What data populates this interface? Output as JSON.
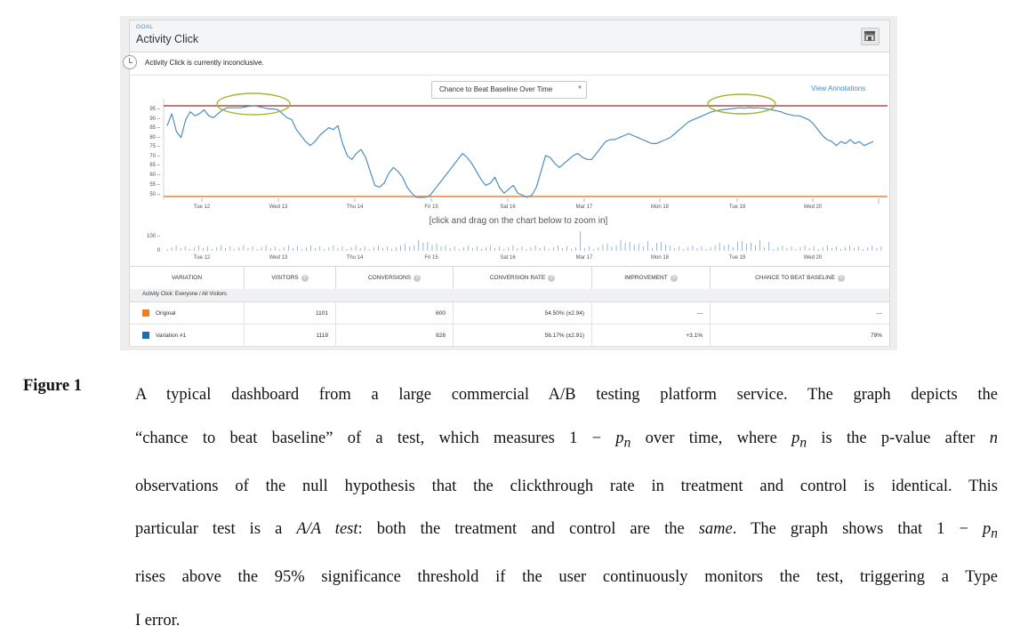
{
  "dashboard": {
    "goal_tag": "GOAL",
    "goal_title": "Activity Click",
    "status_text": "Activity Click is currently inconclusive.",
    "dropdown_label": "Chance to Beat Baseline Over Time",
    "view_annotations": "View Annotations",
    "zoom_hint": "[click and drag on the chart below to zoom in]",
    "colors": {
      "line": "#4a90c2",
      "threshold": "#9c2b22",
      "baseline": "#e8833a",
      "highlight": "#9cb82e"
    }
  },
  "chart_data": {
    "type": "line",
    "x_ticks": [
      "Tue 12",
      "Wed 13",
      "Thu 14",
      "Fri 15",
      "Sat 16",
      "Mar 17",
      "Mon 18",
      "Tue 19",
      "Wed 20"
    ],
    "y_ticks": [
      "95",
      "90",
      "85",
      "80",
      "75",
      "70",
      "65",
      "60",
      "55",
      "50"
    ],
    "ylim": [
      50,
      97
    ],
    "threshold": 95,
    "baseline": 50,
    "series": [
      {
        "values": [
          87,
          93,
          84,
          81,
          90,
          94,
          92,
          93,
          95,
          92,
          91,
          93,
          95,
          96,
          96,
          96,
          96,
          96.5,
          96.8,
          97,
          96.5,
          96,
          95.5,
          95.5,
          95,
          93,
          91,
          90,
          85,
          82,
          79,
          77,
          79,
          82,
          84,
          86,
          85,
          87,
          78,
          72,
          70,
          73,
          75,
          71,
          64,
          57,
          56,
          58,
          63,
          66,
          64,
          61,
          56,
          53,
          51,
          50,
          51,
          52,
          55,
          58,
          61,
          64,
          67,
          70,
          73,
          71,
          68,
          64,
          60,
          57,
          58,
          61,
          56,
          53,
          55,
          57,
          53,
          52,
          51,
          52,
          56,
          64,
          72,
          71,
          68,
          66,
          68,
          70,
          72,
          73,
          71,
          70,
          70,
          73,
          76,
          79,
          80,
          80,
          81,
          82,
          83,
          82,
          81,
          80,
          79,
          78,
          78,
          79,
          80,
          81,
          83,
          85,
          87,
          89,
          90,
          91,
          92,
          93,
          94,
          94.5,
          95,
          95.2,
          95.5,
          95.7,
          96,
          95.8,
          96.1,
          95.9,
          96,
          95.8,
          95.5,
          95,
          94.5,
          94,
          93,
          92.5,
          92,
          92,
          91,
          90,
          88,
          85,
          82,
          80,
          79,
          77,
          79,
          78,
          80,
          78,
          79,
          77,
          78,
          79
        ]
      }
    ],
    "volume_ylim_label": "100",
    "volume_zero_label": "0"
  },
  "table": {
    "headers": [
      "VARIATION",
      "VISITORS",
      "CONVERSIONS",
      "CONVERSION RATE",
      "IMPROVEMENT",
      "CHANCE TO BEAT BASELINE"
    ],
    "segment": "Activity Click: Everyone / All Visitors",
    "rows": [
      {
        "name": "Original",
        "color": "#ef7d22",
        "visitors": "1101",
        "conversions": "600",
        "rate": "54.50% (±2.94)",
        "improvement": "---",
        "chance": "---"
      },
      {
        "name": "Variation #1",
        "color": "#1f6fb0",
        "visitors": "1118",
        "conversions": "628",
        "rate": "56.17% (±2.91)",
        "improvement": "+3.1%",
        "chance": "79%"
      }
    ]
  },
  "figure": {
    "label": "Figure 1",
    "line1": "A typical dashboard from a large commercial A/B testing platform service. The graph depicts the",
    "line2a": "“chance to beat baseline” of a test, which measures 1 − ",
    "line2b": "p",
    "line2c": "n",
    "line2d": " over time, where ",
    "line2e": " is the p-value after ",
    "line2f": "n",
    "line3": "observations of the null hypothesis that the clickthrough rate in treatment and control is identical. This",
    "line4a": "particular test is a ",
    "line4b": "A/A test",
    "line4c": ": both the treatment and control are the ",
    "line4d": "same",
    "line4e": ". The graph shows that 1 − ",
    "line5": "rises above the 95% significance threshold if the user continuously monitors the test, triggering a Type",
    "line6": "I error."
  }
}
